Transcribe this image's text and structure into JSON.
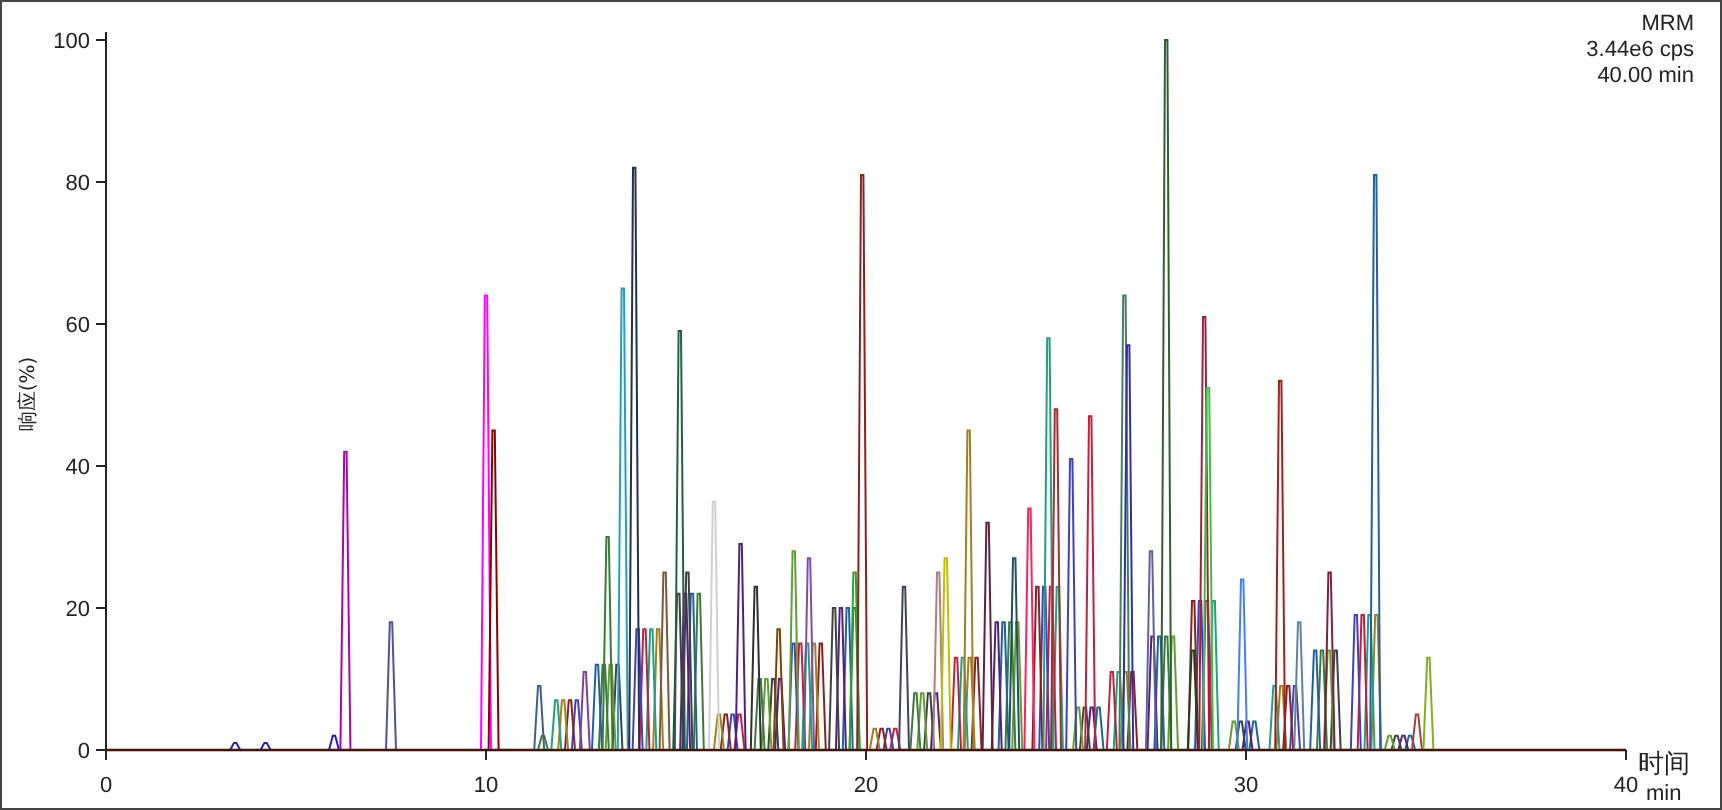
{
  "chart": {
    "info": [
      "MRM",
      "3.44e6 cps",
      "40.00 min"
    ],
    "ylabel": "响应(%)",
    "xlabel": "时间",
    "xunit": "min",
    "xticks": [
      "0",
      "10",
      "20",
      "30",
      "40"
    ],
    "yticks": [
      "100",
      "80",
      "60",
      "40",
      "20",
      "0"
    ]
  }
}
